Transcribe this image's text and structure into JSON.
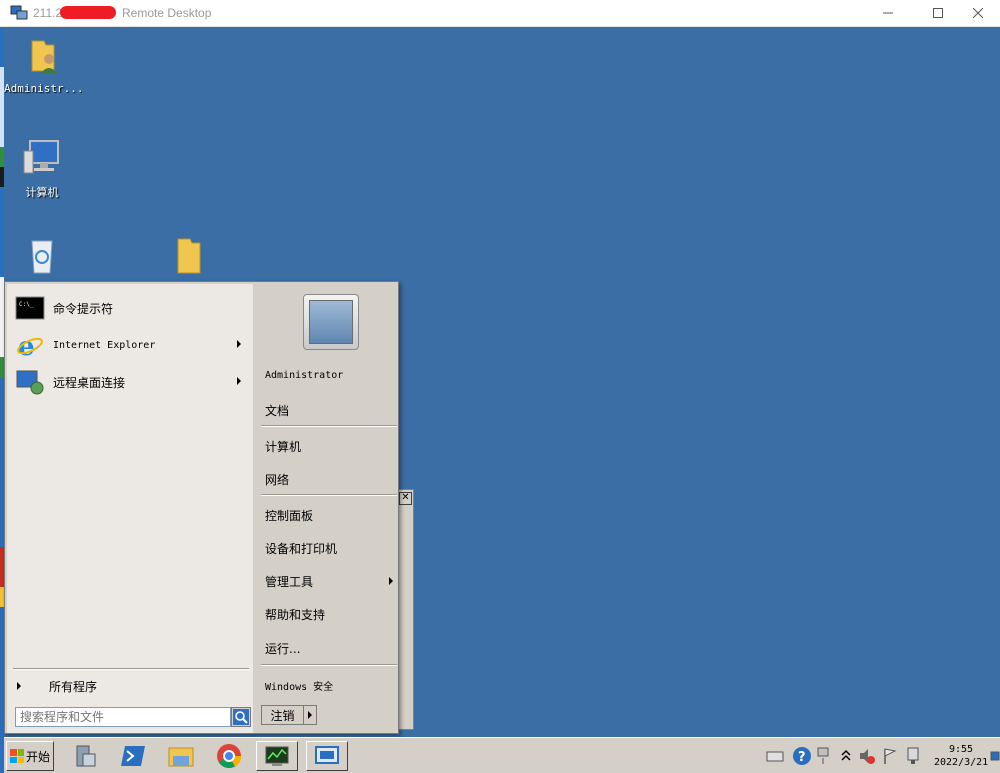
{
  "window": {
    "host_prefix": "211.2",
    "title": "Remote Desktop",
    "icons": {
      "app": "remote-desktop-icon",
      "minimize": "minimize-icon",
      "maximize": "maximize-icon",
      "close": "close-icon"
    }
  },
  "desktop": {
    "background": "#3a6ea5",
    "icons": [
      {
        "label": "Administr...",
        "icon": "user-folder-icon"
      },
      {
        "label": "计算机",
        "icon": "computer-icon"
      },
      {
        "label": "",
        "icon": "recycle-bin-icon"
      },
      {
        "label": "",
        "icon": "folder-icon"
      }
    ]
  },
  "start_menu": {
    "pinned": [
      {
        "label": "命令提示符",
        "icon": "command-prompt-icon",
        "has_submenu": false
      },
      {
        "label": "Internet Explorer",
        "icon": "internet-explorer-icon",
        "has_submenu": true
      },
      {
        "label": "远程桌面连接",
        "icon": "remote-desktop-connection-icon",
        "has_submenu": true
      }
    ],
    "all_programs": "所有程序",
    "search_placeholder": "搜索程序和文件",
    "right": {
      "user": "Administrator",
      "documents": "文档",
      "computer": "计算机",
      "network": "网络",
      "control_panel": "控制面板",
      "devices_printers": "设备和打印机",
      "admin_tools": "管理工具",
      "help_support": "帮助和支持",
      "run": "运行...",
      "windows_security": "Windows 安全"
    },
    "logoff": "注销"
  },
  "taskbar": {
    "start_label": "开始",
    "apps": [
      "server-manager-icon",
      "powershell-icon",
      "file-explorer-icon",
      "chrome-icon",
      "task-manager-icon",
      "rdp-window-icon"
    ],
    "clock_time": "9:55",
    "clock_date": "2022/3/21"
  }
}
